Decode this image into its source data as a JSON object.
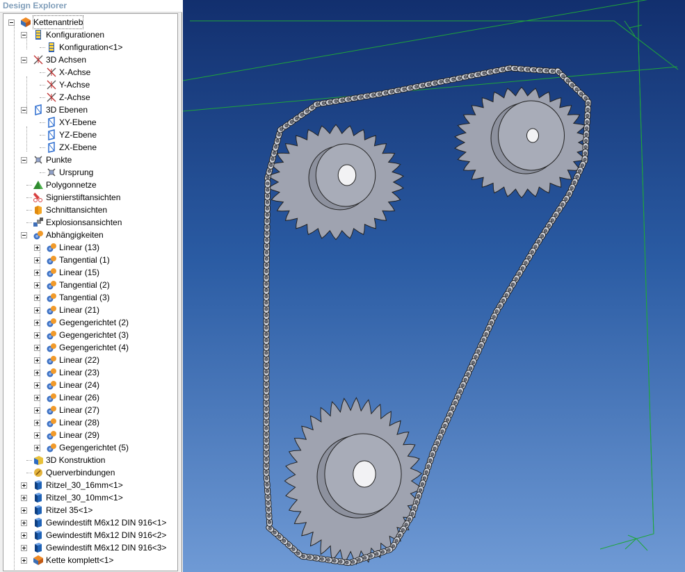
{
  "panel": {
    "title": "Design Explorer"
  },
  "tree": {
    "items": [
      {
        "label": "Kettenantrieb",
        "icon": "assembly-icon"
      },
      {
        "label": "Konfigurationen",
        "icon": "configurations-icon"
      },
      {
        "label": "Konfiguration<1>",
        "icon": "configuration-icon"
      },
      {
        "label": "3D Achsen",
        "icon": "axes-icon"
      },
      {
        "label": "X-Achse",
        "icon": "axis-icon"
      },
      {
        "label": "Y-Achse",
        "icon": "axis-icon"
      },
      {
        "label": "Z-Achse",
        "icon": "axis-icon"
      },
      {
        "label": "3D Ebenen",
        "icon": "planes-icon"
      },
      {
        "label": "XY-Ebene",
        "icon": "plane-icon"
      },
      {
        "label": "YZ-Ebene",
        "icon": "plane-icon"
      },
      {
        "label": "ZX-Ebene",
        "icon": "plane-icon"
      },
      {
        "label": "Punkte",
        "icon": "points-icon"
      },
      {
        "label": "Ursprung",
        "icon": "point-icon"
      },
      {
        "label": "Polygonnetze",
        "icon": "mesh-icon"
      },
      {
        "label": "Signierstiftansichten",
        "icon": "markup-icon"
      },
      {
        "label": "Schnittansichten",
        "icon": "section-icon"
      },
      {
        "label": "Explosionsansichten",
        "icon": "explode-icon"
      },
      {
        "label": "Abhängigkeiten",
        "icon": "constraints-icon"
      },
      {
        "label": "Linear (13)",
        "icon": "constraint-icon"
      },
      {
        "label": "Tangential (1)",
        "icon": "constraint-icon"
      },
      {
        "label": "Linear (15)",
        "icon": "constraint-icon"
      },
      {
        "label": "Tangential (2)",
        "icon": "constraint-icon"
      },
      {
        "label": "Tangential (3)",
        "icon": "constraint-icon"
      },
      {
        "label": "Linear (21)",
        "icon": "constraint-icon"
      },
      {
        "label": "Gegengerichtet (2)",
        "icon": "constraint-icon"
      },
      {
        "label": "Gegengerichtet (3)",
        "icon": "constraint-icon"
      },
      {
        "label": "Gegengerichtet (4)",
        "icon": "constraint-icon"
      },
      {
        "label": "Linear (22)",
        "icon": "constraint-icon"
      },
      {
        "label": "Linear (23)",
        "icon": "constraint-icon"
      },
      {
        "label": "Linear (24)",
        "icon": "constraint-icon"
      },
      {
        "label": "Linear (26)",
        "icon": "constraint-icon"
      },
      {
        "label": "Linear (27)",
        "icon": "constraint-icon"
      },
      {
        "label": "Linear (28)",
        "icon": "constraint-icon"
      },
      {
        "label": "Linear (29)",
        "icon": "constraint-icon"
      },
      {
        "label": "Gegengerichtet (5)",
        "icon": "constraint-icon"
      },
      {
        "label": "3D Konstruktion",
        "icon": "construction-icon"
      },
      {
        "label": "Querverbindungen",
        "icon": "link-icon"
      },
      {
        "label": "Ritzel_30_16mm<1>",
        "icon": "part-icon"
      },
      {
        "label": "Ritzel_30_10mm<1>",
        "icon": "part-icon"
      },
      {
        "label": "Ritzel 35<1>",
        "icon": "part-icon"
      },
      {
        "label": "Gewindestift M6x12 DIN 916<1>",
        "icon": "part-icon"
      },
      {
        "label": "Gewindestift M6x12 DIN 916<2>",
        "icon": "part-icon"
      },
      {
        "label": "Gewindestift M6x12 DIN 916<3>",
        "icon": "part-icon"
      },
      {
        "label": "Kette komplett<1>",
        "icon": "assembly-icon"
      }
    ]
  },
  "viewport": {
    "background_top": "#122f6e",
    "background_bottom": "#6f9ad5",
    "grid_color": "#1fa63a",
    "part_color": "#9fa3b0"
  }
}
